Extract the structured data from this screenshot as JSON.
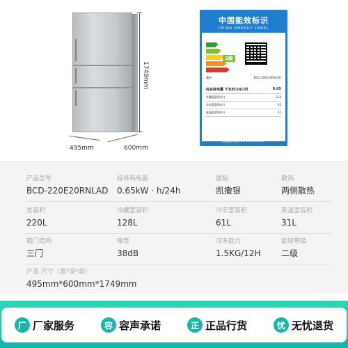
{
  "dimensions": {
    "height": "1749mm",
    "width": "495mm",
    "depth": "600mm"
  },
  "energy_label": {
    "title": "中国能效标识",
    "subtitle": "CHINA ENERGY LABEL",
    "grade": "2级",
    "model": "BCD-220E20RNLAD",
    "brand": "美的",
    "rows": [
      {
        "k": "综合耗电量 千瓦时/24小时",
        "v": "0.65"
      },
      {
        "k": "冷藏室容积(升)",
        "v": "128"
      },
      {
        "k": "冷冻室容积(升)",
        "v": "61"
      },
      {
        "k": "变温室容积(升)",
        "v": "31"
      }
    ],
    "footer": "依据国家标准: GB 12021.2-2015"
  },
  "specs": {
    "model_k": "产品型号",
    "model_v": "BCD-220E20RNLAD",
    "power_k": "综合耗电量",
    "power_v": "0.65kW · h/24h",
    "panel_k": "面板",
    "panel_v": "凯撒银",
    "cool_k": "散热",
    "cool_v": "两侧散热",
    "total_k": "总容积",
    "total_v": "220L",
    "fridge_k": "冷藏室容积",
    "fridge_v": "128L",
    "freezer_k": "冷冻室容积",
    "freezer_v": "61L",
    "var_k": "变温室容积",
    "var_v": "31L",
    "doors_k": "箱门结构",
    "doors_v": "三门",
    "noise_k": "噪音",
    "noise_v": "38dB",
    "freeze_k": "冷冻能力",
    "freeze_v": "1.5KG/12H",
    "grade_k": "能效等级",
    "grade_v": "二级",
    "size_k": "产品 尺寸（宽*深*高）",
    "size_v": "495mm*600mm*1749mm"
  },
  "service": {
    "items": [
      {
        "icon": "厂",
        "label": "厂家服务"
      },
      {
        "icon": "容",
        "label": "容声承诺"
      },
      {
        "icon": "正",
        "label": "正品行货"
      },
      {
        "icon": "忧",
        "label": "无忧退货"
      }
    ],
    "accent": "#16b7a6"
  }
}
